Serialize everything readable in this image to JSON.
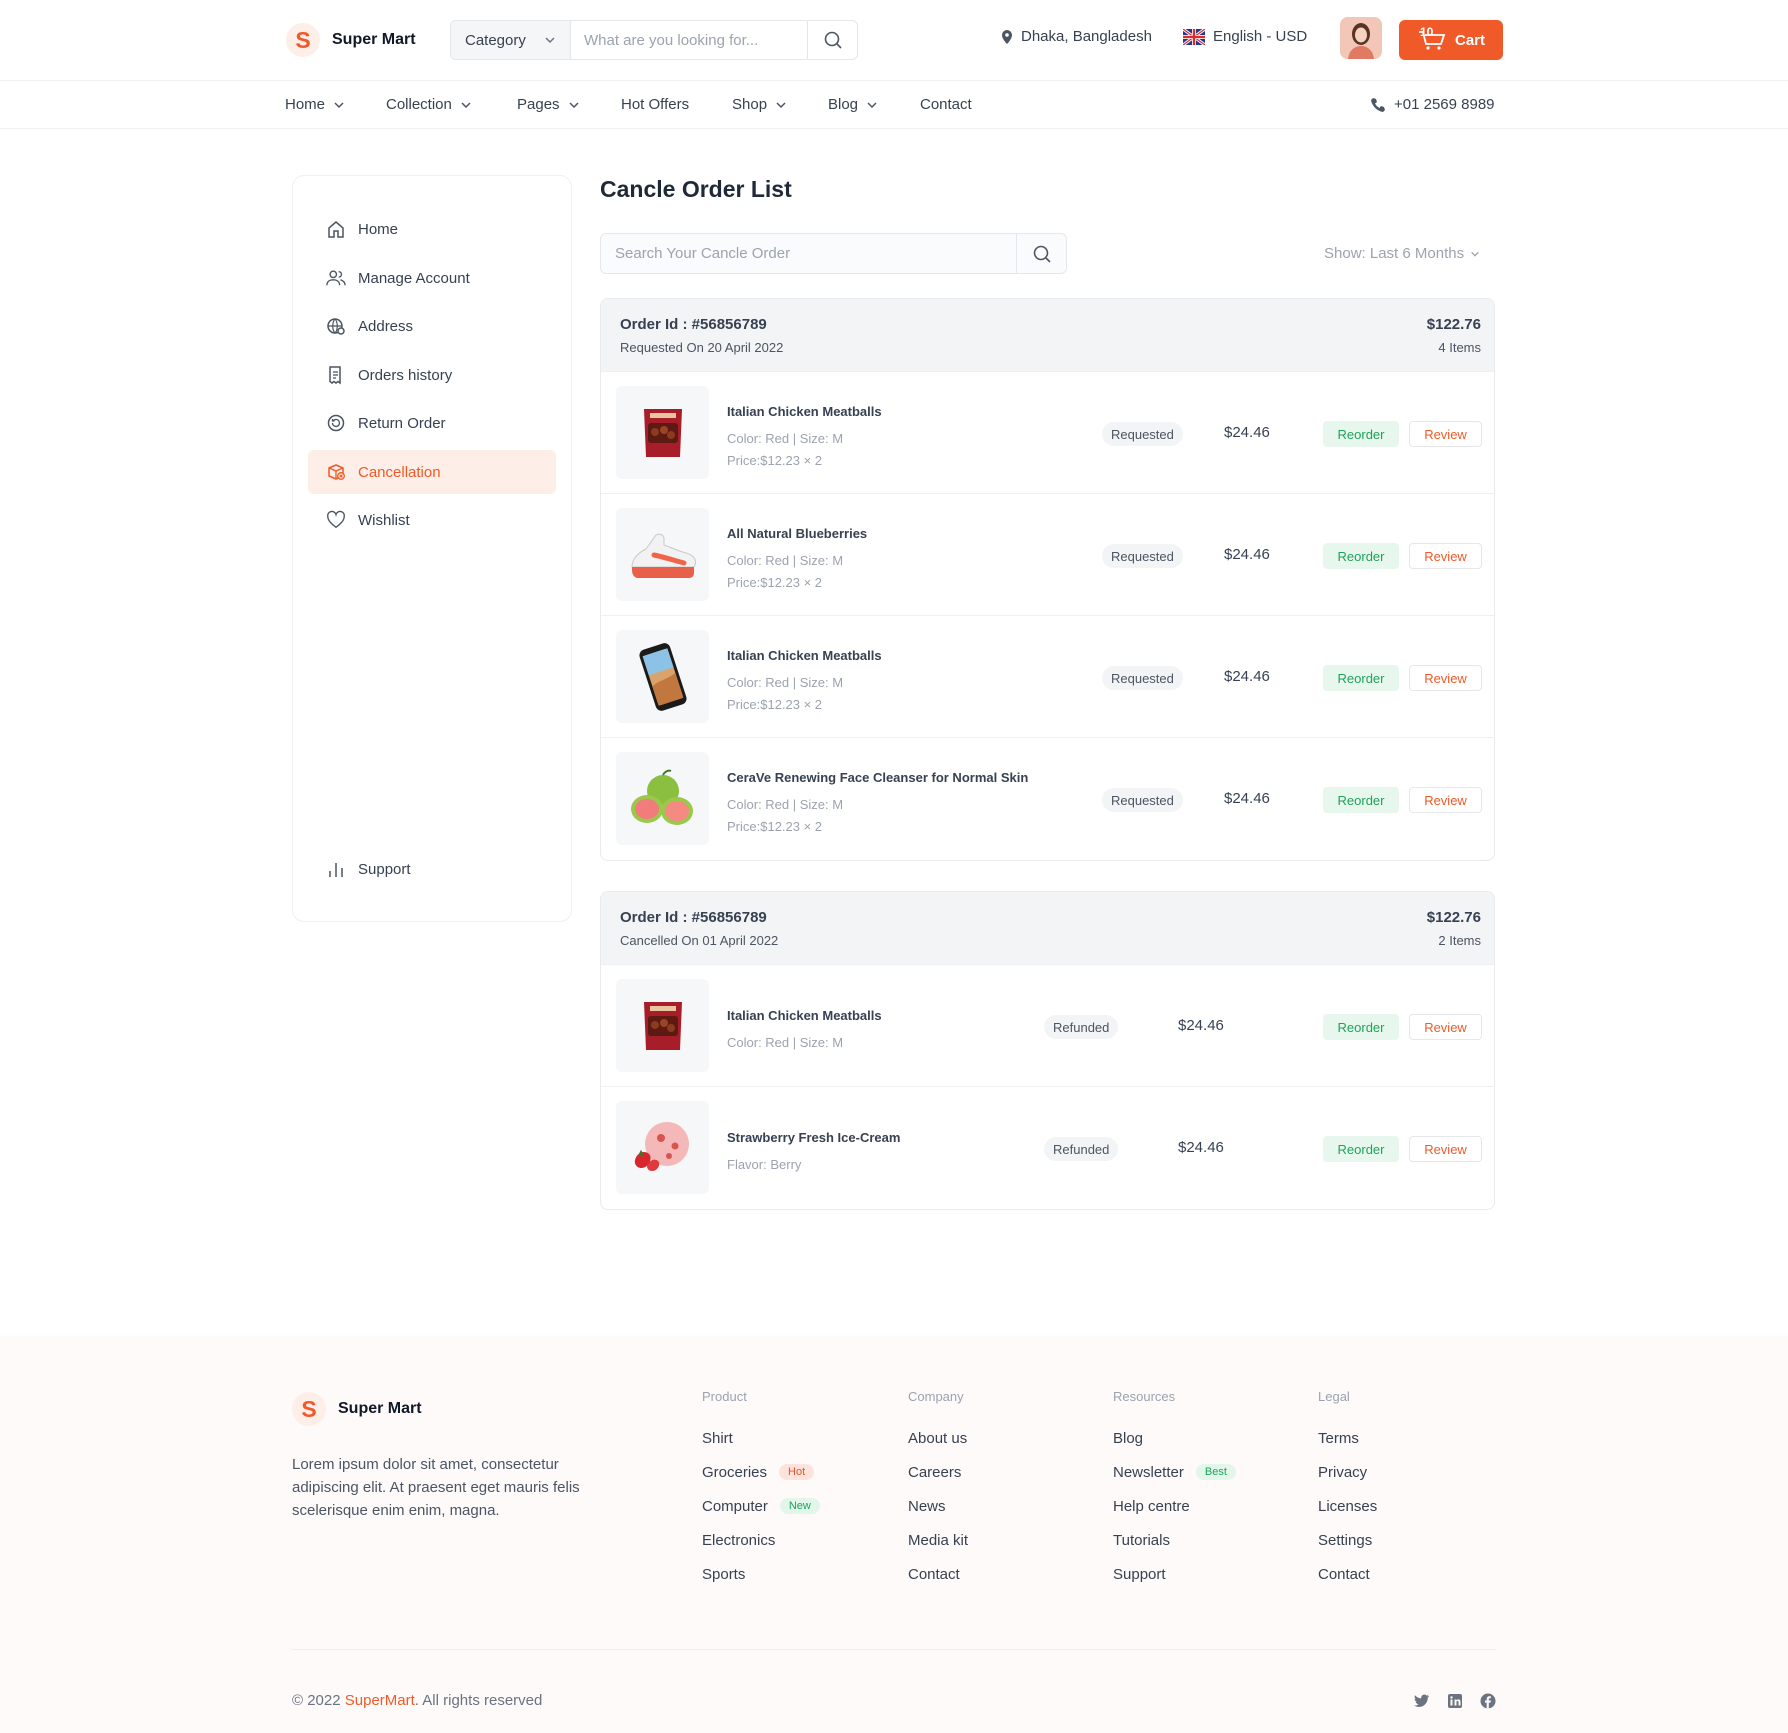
{
  "header": {
    "brand": "Super Mart",
    "brand_initial": "S",
    "category_label": "Category",
    "search_placeholder": "What are you looking for...",
    "location": "Dhaka, Bangladesh",
    "language": "English - USD",
    "cart_label": "Cart",
    "cart_count": "10"
  },
  "nav": {
    "items": [
      "Home",
      "Collection",
      "Pages",
      "Hot Offers",
      "Shop",
      "Blog",
      "Contact"
    ],
    "phone": "+01 2569 8989"
  },
  "sidebar": {
    "items": [
      "Home",
      "Manage Account",
      "Address",
      "Orders history",
      "Return Order",
      "Cancellation",
      "Wishlist"
    ],
    "active": "Cancellation",
    "support": "Support"
  },
  "page": {
    "title": "Cancle Order List",
    "search_placeholder": "Search Your Cancle Order",
    "show_filter": "Show: Last 6 Months"
  },
  "orders": [
    {
      "id": "Order Id : #56856789",
      "date": "Requested On 20 April 2022",
      "total": "$122.76",
      "items_count": "4 Items",
      "rows": [
        {
          "name": "Italian Chicken Meatballs",
          "meta": "Color: Red | Size: M",
          "price": "Price:$12.23 × 2",
          "status": "Requested",
          "amount": "$24.46"
        },
        {
          "name": "All Natural Blueberries",
          "meta": "Color: Red | Size: M",
          "price": "Price:$12.23 × 2",
          "status": "Requested",
          "amount": "$24.46"
        },
        {
          "name": "Italian Chicken Meatballs",
          "meta": "Color: Red | Size: M",
          "price": "Price:$12.23 × 2",
          "status": "Requested",
          "amount": "$24.46"
        },
        {
          "name": "CeraVe Renewing Face Cleanser for Normal Skin",
          "meta": "Color: Red | Size: M",
          "price": "Price:$12.23 × 2",
          "status": "Requested",
          "amount": "$24.46"
        }
      ]
    },
    {
      "id": "Order Id : #56856789",
      "date": "Cancelled On 01 April 2022",
      "total": "$122.76",
      "items_count": "2 Items",
      "rows": [
        {
          "name": "Italian Chicken Meatballs",
          "meta": "Color: Red | Size: M",
          "status": "Refunded",
          "amount": "$24.46"
        },
        {
          "name": "Strawberry Fresh Ice-Cream",
          "meta": "Flavor: Berry",
          "status": "Refunded",
          "amount": "$24.46"
        }
      ]
    }
  ],
  "actions": {
    "reorder": "Reorder",
    "review": "Review"
  },
  "footer": {
    "brand": "Super Mart",
    "brand_initial": "S",
    "description": "Lorem ipsum dolor sit amet, consectetur adipiscing elit. At praesent eget mauris felis scelerisque enim enim, magna.",
    "columns": [
      {
        "title": "Product",
        "links": [
          "Shirt",
          "Groceries",
          "Computer",
          "Electronics",
          "Sports"
        ]
      },
      {
        "title": "Company",
        "links": [
          "About us",
          "Careers",
          "News",
          "Media kit",
          "Contact"
        ]
      },
      {
        "title": "Resources",
        "links": [
          "Blog",
          "Newsletter",
          "Help centre",
          "Tutorials",
          "Support"
        ]
      },
      {
        "title": "Legal",
        "links": [
          "Terms",
          "Privacy",
          "Licenses",
          "Settings",
          "Contact"
        ]
      }
    ],
    "badges": {
      "hot": "Hot",
      "new": "New",
      "best": "Best"
    },
    "copyright_prefix": "© 2022 ",
    "copyright_brand": "SuperMart",
    "copyright_suffix": ". All rights reserved",
    "social_icons": [
      "twitter-icon",
      "linkedin-icon",
      "facebook-icon"
    ]
  },
  "colors": {
    "accent": "#f05a28",
    "success": "#1ea35a",
    "muted": "#9ca3af"
  }
}
